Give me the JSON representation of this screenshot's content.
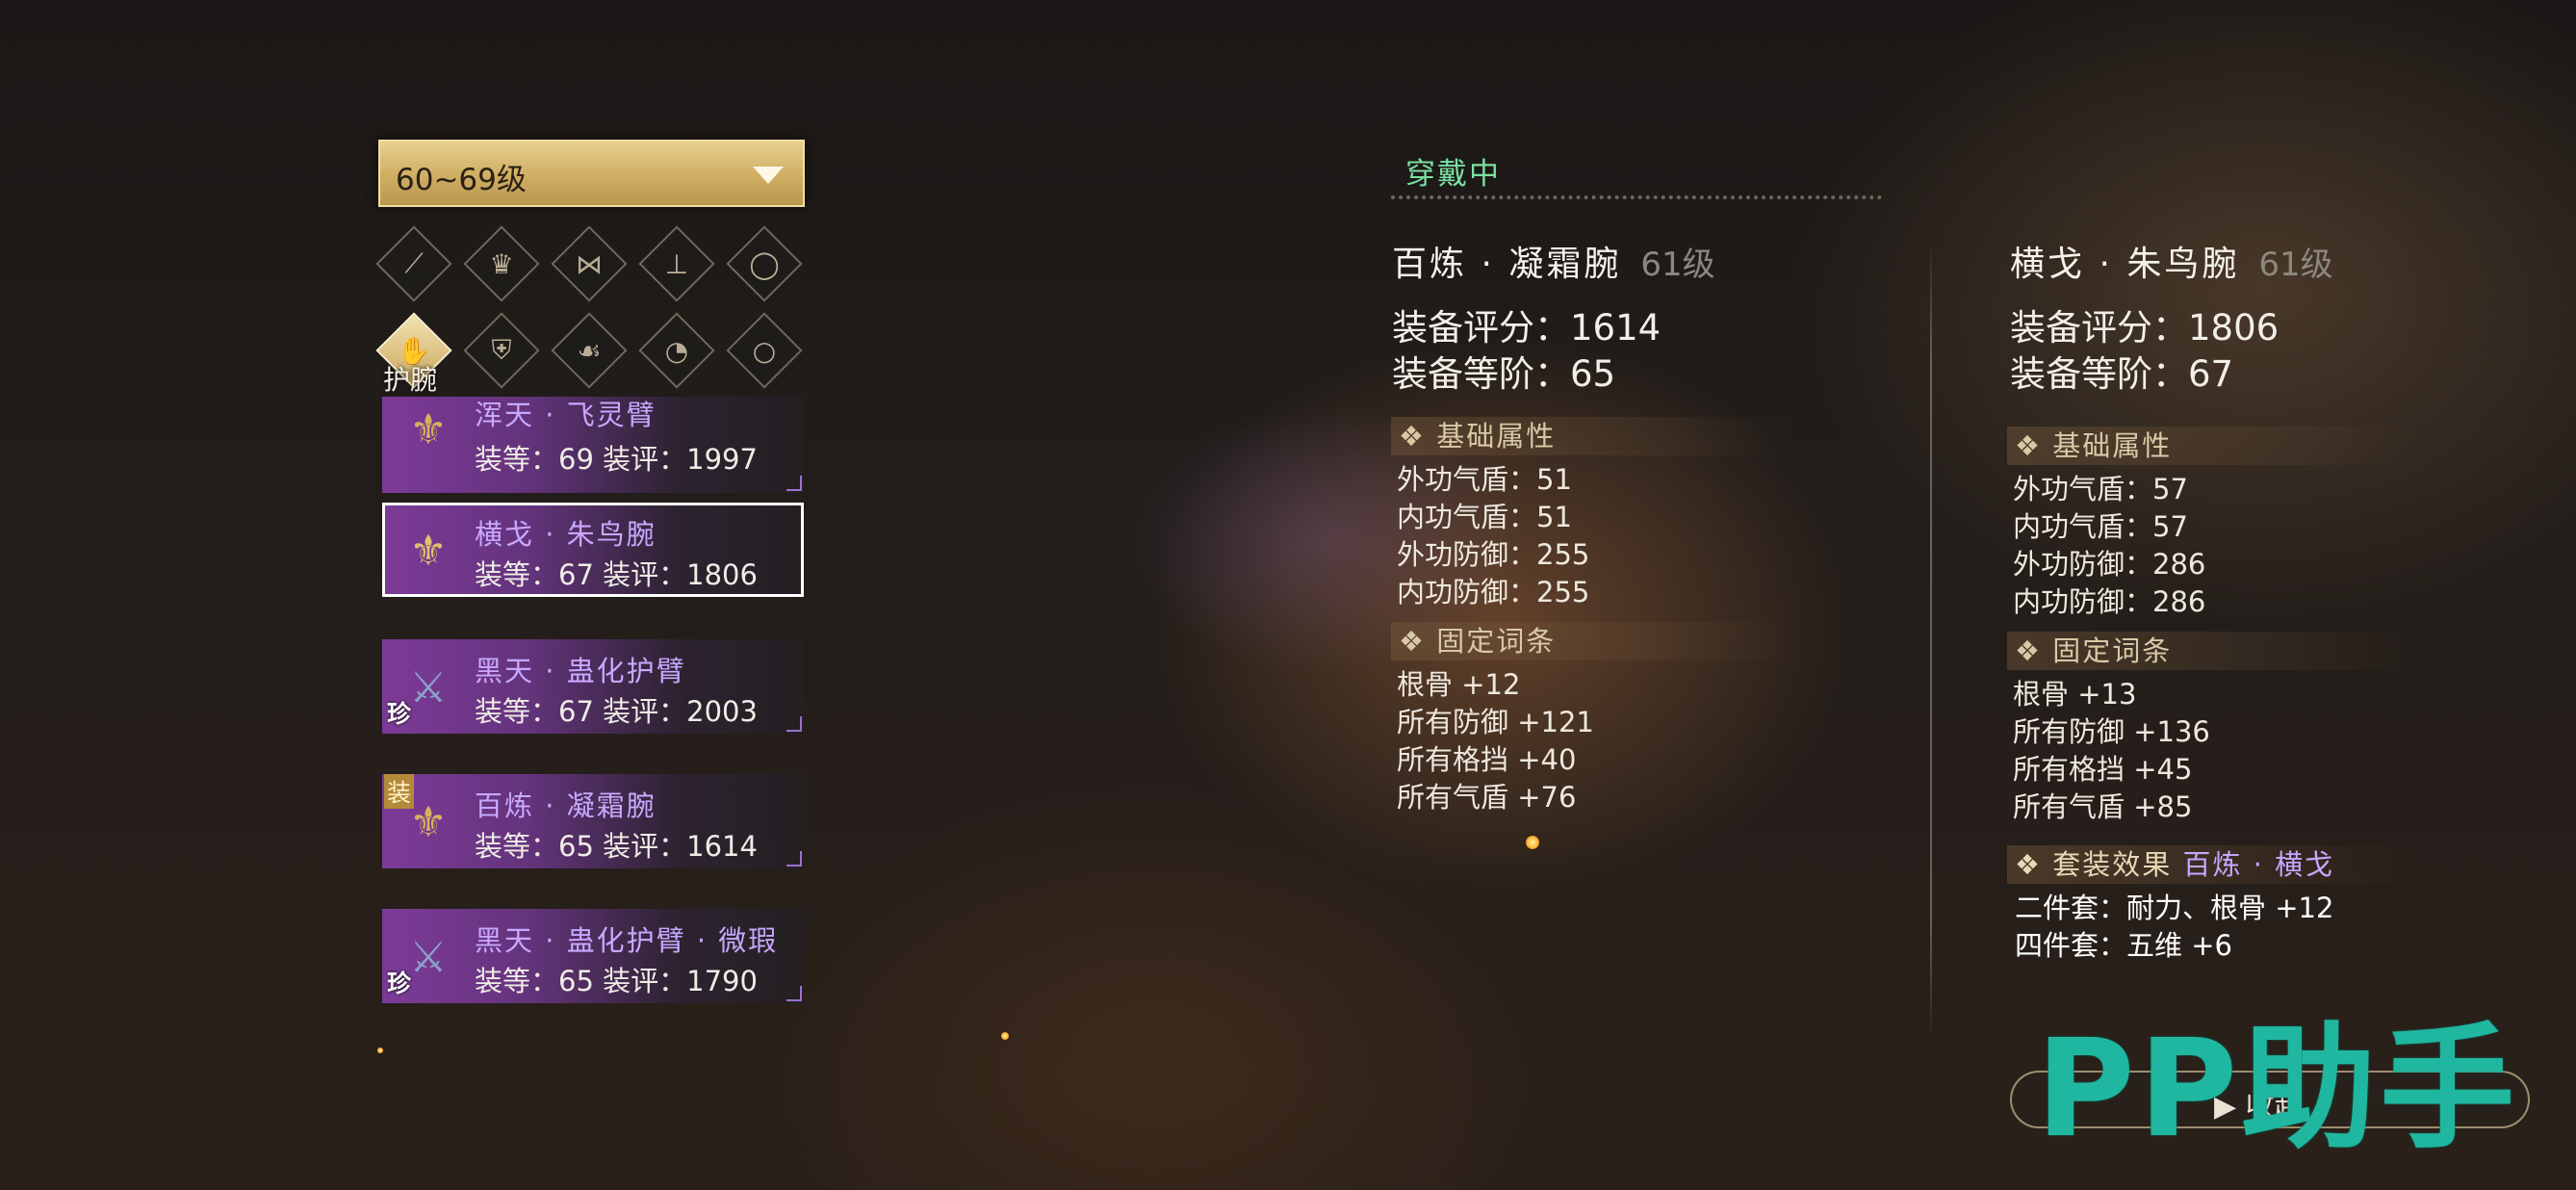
{
  "filter": {
    "level_range": "60~69级"
  },
  "categories": {
    "selected_label": "护腕",
    "icons": [
      "weapon-icon",
      "helmet-icon",
      "belt-icon",
      "boots-icon",
      "ring-icon",
      "bracer-icon",
      "armor-icon",
      "glove-icon",
      "pendant-icon",
      "necklace-icon"
    ]
  },
  "items": [
    {
      "name": "浑天 · 飞灵臂",
      "stats": "装等：69 装评：1997",
      "badge": ""
    },
    {
      "name": "横戈 · 朱鸟腕",
      "stats": "装等：67 装评：1806",
      "badge": ""
    },
    {
      "name": "黑天 · 蛊化护臂",
      "stats": "装等：67 装评：2003",
      "badge": "珍"
    },
    {
      "name": "百炼 · 凝霜腕",
      "stats": "装等：65 装评：1614",
      "badge": "",
      "equip_tag": "装"
    },
    {
      "name": "黑天 · 蛊化护臂 · 微瑕",
      "stats": "装等：65 装评：1790",
      "badge": "珍"
    }
  ],
  "current": {
    "tag": "穿戴中",
    "name": "百炼 · 凝霜腕",
    "level": "61级",
    "score": "装备评分：1614",
    "tier": "装备等阶：65",
    "basic_title": "❖ 基础属性",
    "basic": [
      "外功气盾：51",
      "内功气盾：51",
      "外功防御：255",
      "内功防御：255"
    ],
    "fixed_title": "❖ 固定词条",
    "fixed": [
      "根骨 +12",
      "所有防御 +121",
      "所有格挡 +40",
      "所有气盾 +76"
    ]
  },
  "compare": {
    "name": "横戈 · 朱鸟腕",
    "level": "61级",
    "score": "装备评分：1806",
    "tier": "装备等阶：67",
    "basic_title": "❖ 基础属性",
    "basic": [
      "外功气盾：57",
      "内功气盾：57",
      "外功防御：286",
      "内功防御：286"
    ],
    "fixed_title": "❖ 固定词条",
    "fixed": [
      "根骨 +13",
      "所有防御 +136",
      "所有格挡 +45",
      "所有气盾 +85"
    ],
    "set_title": "❖ 套装效果",
    "set_name": "百炼 · 横戈",
    "set": [
      "二件套：耐力、根骨 +12",
      "四件套：五维 +6"
    ]
  },
  "collapse_label": "▶ 收起",
  "watermark": "PP助手"
}
